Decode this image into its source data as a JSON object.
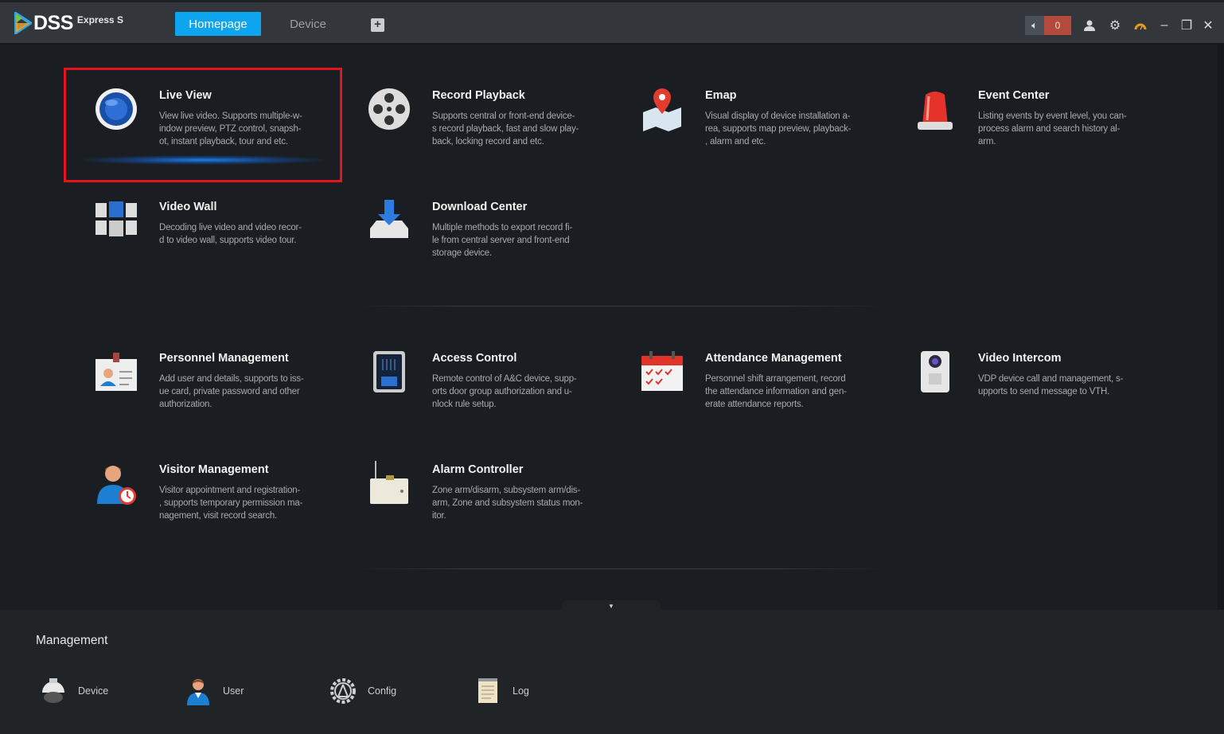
{
  "app": {
    "logo": "DSS",
    "logo_sub": "Express S"
  },
  "tabs": [
    {
      "label": "Homepage",
      "active": true
    },
    {
      "label": "Device",
      "active": false
    }
  ],
  "add_tab_label": "+",
  "toolbar": {
    "alarm_count": "0",
    "icons": [
      "speaker-icon",
      "user-icon",
      "gear-icon",
      "performance-gauge-icon",
      "minimize-icon",
      "restore-icon",
      "close-icon"
    ]
  },
  "modules": [
    {
      "title": "Live View",
      "desc": "View live video. Supports multiple-w-\nindow preview, PTZ control, snapsh-\not, instant playback, tour and etc.",
      "selected": true
    },
    {
      "title": "Record Playback",
      "desc": "Supports central or front-end device-\ns record playback, fast and slow play-\nback, locking record and etc."
    },
    {
      "title": "Emap",
      "desc": "Visual display of device installation a-\nrea, supports map preview, playback-\n, alarm and etc."
    },
    {
      "title": "Event Center",
      "desc": "Listing events by event level, you can-\nprocess alarm and search history al-\narm."
    },
    {
      "title": "Video Wall",
      "desc": "Decoding live video and video recor-\nd to video wall, supports video tour."
    },
    {
      "title": "Download Center",
      "desc": "Multiple methods to export record fi-\nle from central server and front-end\nstorage device."
    },
    {
      "title": "Personnel Management",
      "desc": "Add user and details, supports to iss-\nue card, private password and other\nauthorization."
    },
    {
      "title": "Access Control",
      "desc": "Remote control of A&C device, supp-\norts door group authorization and u-\nnlock rule setup."
    },
    {
      "title": "Attendance Management",
      "desc": "Personnel shift arrangement, record\nthe attendance information and gen-\nerate attendance reports."
    },
    {
      "title": "Video Intercom",
      "desc": "VDP device call and management, s-\nupports to send message to VTH."
    },
    {
      "title": "Visitor Management",
      "desc": "Visitor appointment and registration-\n, supports temporary permission ma-\nnagement, visit record search."
    },
    {
      "title": "Alarm Controller",
      "desc": "Zone arm/disarm, subsystem arm/dis-\narm, Zone and subsystem status mon-\nitor."
    }
  ],
  "management": {
    "title": "Management",
    "items": [
      {
        "label": "Device"
      },
      {
        "label": "User"
      },
      {
        "label": "Config"
      },
      {
        "label": "Log"
      }
    ]
  },
  "colors": {
    "accent": "#0ea5f0",
    "selection": "#e4141b",
    "alarm": "#b34a3c"
  }
}
